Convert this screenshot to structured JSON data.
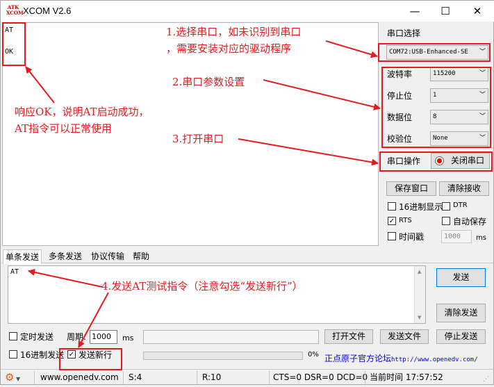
{
  "titlebar": {
    "logo_line1": "ATK",
    "logo_line2": "XCOM",
    "title": "XCOM V2.6",
    "minimize": "—",
    "maximize": "☐",
    "close": "✕"
  },
  "receive": {
    "line1": "AT",
    "line2": "OK"
  },
  "right_panel": {
    "port_select_label": "串口选择",
    "port_value": "COM72:USB-Enhanced-SE",
    "baud_label": "波特率",
    "baud_value": "115200",
    "stop_label": "停止位",
    "stop_value": "1",
    "data_label": "数据位",
    "data_value": "8",
    "parity_label": "校验位",
    "parity_value": "None",
    "port_op_label": "串口操作",
    "close_port_button": "关闭串口",
    "save_window_button": "保存窗口",
    "clear_receive_button": "清除接收",
    "hex_display_label": "16进制显示",
    "dtr_label": "DTR",
    "rts_label": "RTS",
    "auto_save_label": "自动保存",
    "timestamp_label": "时间戳",
    "timestamp_value": "1000",
    "timestamp_unit": "ms"
  },
  "tabs": [
    "单条发送",
    "多条发送",
    "协议传输",
    "帮助"
  ],
  "send": {
    "text": "AT",
    "send_button": "发送",
    "clear_send_button": "清除发送",
    "timed_send_label": "定时发送",
    "period_label": "周期:",
    "period_value": "1000",
    "period_unit": "ms",
    "open_file_button": "打开文件",
    "send_file_button": "发送文件",
    "stop_send_button": "停止发送",
    "hex_send_label": "16进制发送",
    "send_newline_label": "发送新行",
    "progress_text": "0%",
    "progress": 0,
    "forum_link_cn": "正点原子官方论坛",
    "forum_link_url": "http://www.openedv.com/"
  },
  "statusbar": {
    "website": "www.openedv.com",
    "sent": "S:4",
    "received": "R:10",
    "signals": "CTS=0 DSR=0 DCD=0",
    "time_label": "当前时间",
    "time_value": "17:57:52"
  },
  "annotations": {
    "a1_line1": "1.选择串口，如未识别到串口",
    "a1_line2": "，需要安装对应的驱动程序",
    "a2": "2.串口参数设置",
    "a3": "3.打开串口",
    "a4": "4.发送AT测试指令（注意勾选“发送新行”）",
    "a_left_line1": "响应OK，说明AT启动成功，",
    "a_left_line2": "AT指令可以正常使用"
  },
  "colors": {
    "annotation": "#e8191e",
    "link": "#0000ff",
    "port_indicator": "#e00000"
  }
}
